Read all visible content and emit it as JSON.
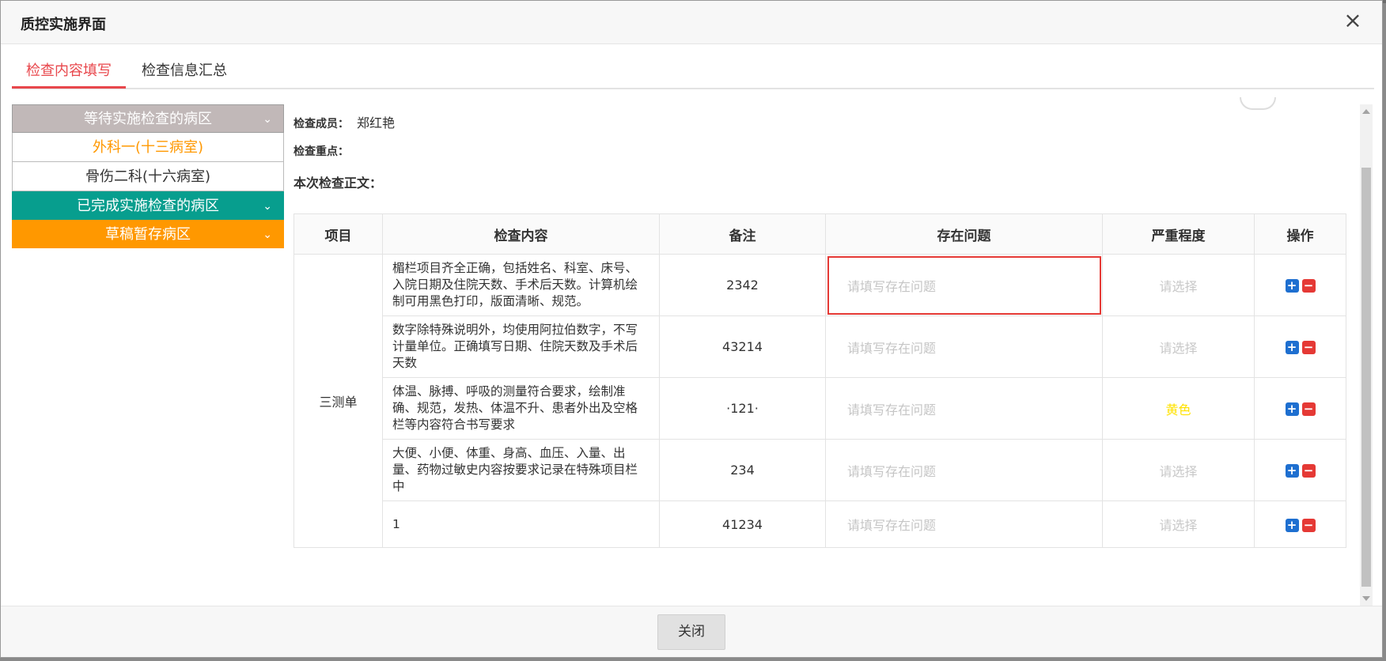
{
  "window": {
    "title": "质控实施界面",
    "close_icon": "×"
  },
  "tabs": [
    {
      "label": "检查内容填写"
    },
    {
      "label": "检查信息汇总"
    }
  ],
  "sidebar": {
    "waiting_header": "等待实施检查的病区",
    "wards": [
      "外科一(十三病室)",
      "骨伤二科(十六病室)"
    ],
    "done_header": "已完成实施检查的病区",
    "draft_header": "草稿暂存病区"
  },
  "info": {
    "member_label": "检查成员：",
    "member_value": "郑红艳",
    "focus_label": "检查重点：",
    "body_label": "本次检查正文："
  },
  "table": {
    "headers": [
      "项目",
      "检查内容",
      "备注",
      "存在问题",
      "严重程度",
      "操作"
    ],
    "group": "三测单",
    "rows": [
      {
        "content": "楣栏项目齐全正确，包括姓名、科室、床号、入院日期及住院天数、手术后天数。计算机绘制可用黑色打印，版面清晰、规范。",
        "note": "2342",
        "problem_placeholder": "请填写存在问题",
        "severity": "请选择"
      },
      {
        "content": "数字除特殊说明外，均使用阿拉伯数字，不写计量单位。正确填写日期、住院天数及手术后天数",
        "note": "43214",
        "problem_placeholder": "请填写存在问题",
        "severity": "请选择"
      },
      {
        "content": "体温、脉搏、呼吸的测量符合要求，绘制准确、规范，发热、体温不升、患者外出及空格栏等内容符合书写要求",
        "note": "·121·",
        "problem_placeholder": "请填写存在问题",
        "severity": "黄色"
      },
      {
        "content": "大便、小便、体重、身高、血压、入量、出量、药物过敏史内容按要求记录在特殊项目栏中",
        "note": "234",
        "problem_placeholder": "请填写存在问题",
        "severity": "请选择"
      },
      {
        "content": "1",
        "note": "41234",
        "problem_placeholder": "请填写存在问题",
        "severity": "请选择"
      }
    ],
    "add_icon": "+",
    "remove_icon": "−"
  },
  "footer": {
    "close_label": "关闭"
  },
  "colors": {
    "accent": "#e8474c",
    "done": "#079e8e",
    "draft": "#ff9800",
    "yellow": "#ffe200"
  }
}
